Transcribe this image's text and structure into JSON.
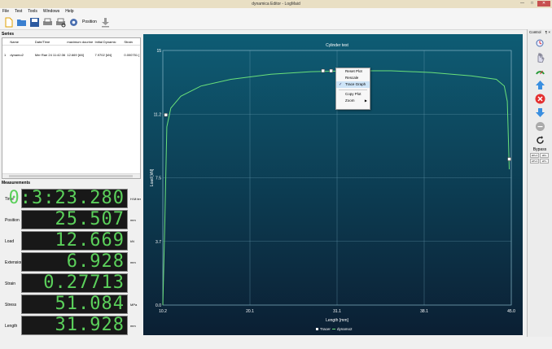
{
  "window": {
    "title": "dynamica Editor - LogMaid"
  },
  "menu": [
    "File",
    "Test",
    "Tools",
    "Windows",
    "Help"
  ],
  "toolbar": {
    "position_label": "Position"
  },
  "series_panel": {
    "title": "Series",
    "columns": [
      "",
      "Name",
      "Date/Time",
      "maximum dourine",
      "Initial Dynamic",
      "Strain"
    ],
    "rows": [
      [
        "1",
        "dynamo2",
        "Mer Rae 24 11:42:36 2016",
        "12.669 [kN]",
        "7.9702 [kN]",
        "0.000751 ["
      ]
    ]
  },
  "measurements": {
    "title": "Measurements",
    "items": [
      {
        "label": "Time",
        "value": "0:3:23.280",
        "unit": "H:M:ter"
      },
      {
        "label": "Position",
        "value": "25.507",
        "unit": "mm"
      },
      {
        "label": "Load",
        "value": "12.669",
        "unit": "kN"
      },
      {
        "label": "Extension",
        "value": "6.928",
        "unit": "mm"
      },
      {
        "label": "Strain",
        "value": "0.27713",
        "unit": ""
      },
      {
        "label": "Stress",
        "value": "51.084",
        "unit": "MPa"
      },
      {
        "label": "Length",
        "value": "31.928",
        "unit": "mm"
      }
    ]
  },
  "context_menu": {
    "items": [
      "Reset Plot",
      "Rescale",
      "Trace Graph",
      "Copy Plot",
      "Zoom"
    ],
    "checked": "Trace Graph"
  },
  "control_panel": {
    "title": "Control",
    "header_buttons": [
      "¶",
      "×"
    ],
    "icons": [
      "zoom-reset-icon",
      "hand-icon",
      "gauge-icon",
      "arrow-up-icon",
      "stop-icon",
      "arrow-down-icon",
      "neutral-icon",
      "refresh-icon"
    ],
    "bypass_label": "Bypass",
    "small_buttons": [
      "eR+1",
      "eR+",
      "eP+1",
      "eP+"
    ],
    "colors": {
      "up": "#3a8fe0",
      "stop": "#e43030",
      "down": "#3a8fe0"
    }
  },
  "chart_data": {
    "type": "line",
    "title": "Cylinder test",
    "xlabel": "Length [mm]",
    "ylabel": "Load [kN]",
    "x_ticks": [
      "10.2",
      "20.1",
      "31.1",
      "38.1",
      "45.0"
    ],
    "y_ticks": [
      "15",
      "11.2",
      "7.5",
      "3.7",
      "0.0"
    ],
    "xlim": [
      10.2,
      45.0
    ],
    "ylim": [
      0,
      15
    ],
    "grid": true,
    "legend": [
      "Tracer",
      "dynamo2"
    ],
    "series": [
      {
        "name": "dynamo2",
        "color": "#6ae07a",
        "x": [
          10.2,
          10.4,
          10.6,
          11.0,
          12.0,
          14.0,
          17.0,
          21.0,
          25.0,
          29.0,
          33.0,
          37.0,
          41.0,
          43.5,
          44.3,
          44.6,
          44.8
        ],
        "y": [
          0.0,
          5.0,
          10.5,
          11.6,
          12.3,
          12.9,
          13.3,
          13.6,
          13.75,
          13.8,
          13.8,
          13.7,
          13.5,
          13.3,
          12.9,
          12.0,
          8.0
        ]
      }
    ],
    "markers": [
      {
        "x": 10.5,
        "y": 11.2
      },
      {
        "x": 26.2,
        "y": 13.8
      },
      {
        "x": 27.0,
        "y": 13.8
      },
      {
        "x": 44.8,
        "y": 8.6
      }
    ]
  }
}
